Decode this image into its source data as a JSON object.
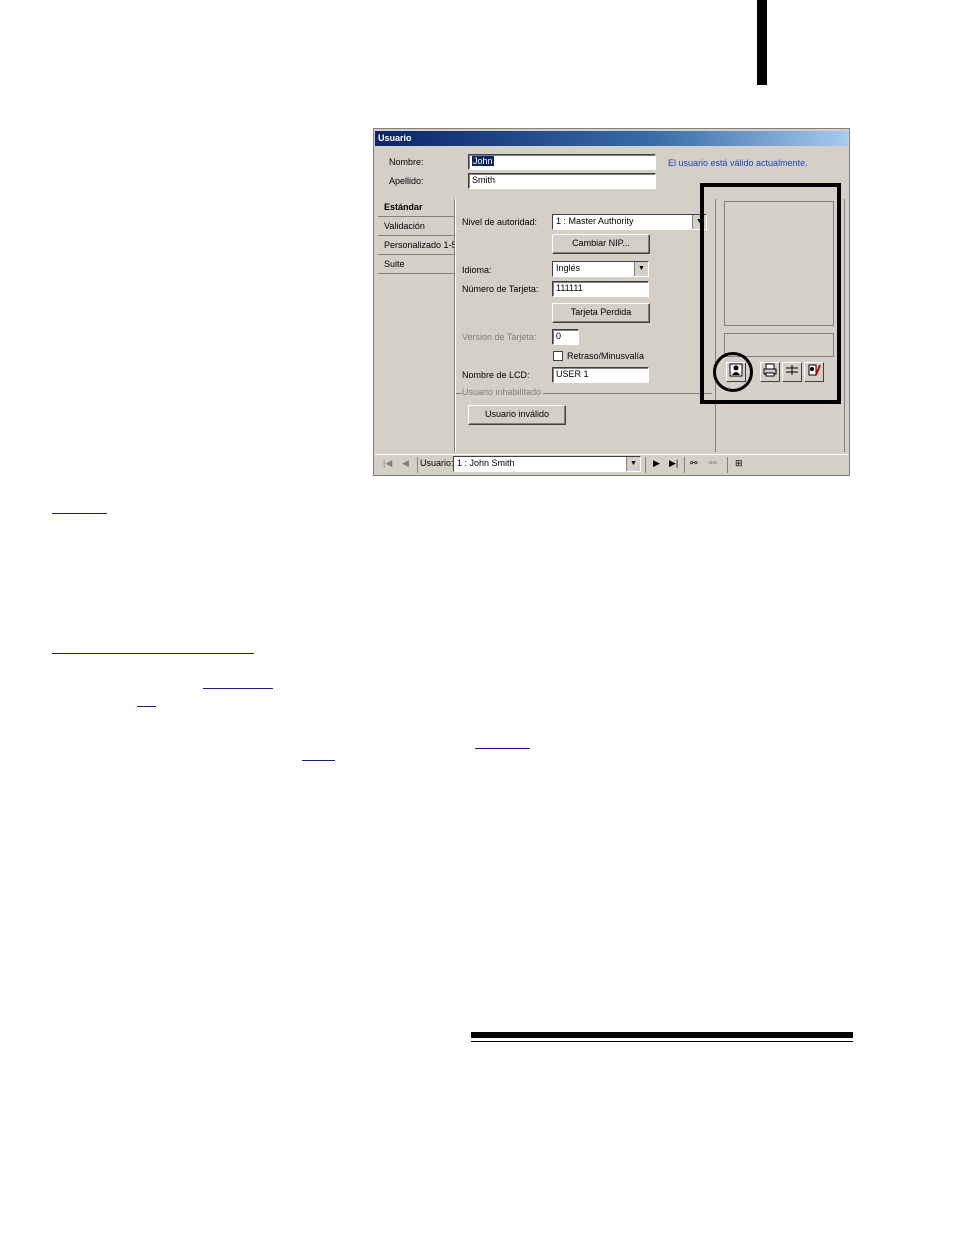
{
  "window": {
    "title": "Usuario",
    "name_label": "Nombre:",
    "name_value": "John",
    "surname_label": "Apellido:",
    "surname_value": "Smith",
    "status_text": "El usuario está válido actualmente."
  },
  "tabs": [
    "Estándar",
    "Validación",
    "Personalizado 1-5",
    "Suite"
  ],
  "standard": {
    "authority_label": "Nivel de autoridad:",
    "authority_value": "1 : Master Authority",
    "change_pin_button": "Cambiar NIP...",
    "language_label": "Idioma:",
    "language_value": "Inglés",
    "card_number_label": "Número de Tarjeta:",
    "card_number_value": "111111",
    "lost_card_button": "Tarjeta Perdida",
    "card_version_label": "Version de Tarjeta:",
    "card_version_value": "0",
    "delay_checkbox_label": "Retraso/Minusvalía",
    "lcd_name_label": "Nombre de LCD:",
    "lcd_name_value": "USER 1",
    "disabled_group_label": "Usuario inhabilitado",
    "invalid_user_button": "Usuario inválido"
  },
  "photo_panel": {
    "icons": [
      "user-photo-icon",
      "print-icon",
      "card-layout-icon",
      "settings-tool-icon"
    ]
  },
  "navbar": {
    "user_label": "Usuario:",
    "user_value": "1 : John Smith",
    "icons": [
      "first-record-icon",
      "prev-record-icon",
      "next-record-icon",
      "last-record-icon",
      "find-icon",
      "find-next-icon",
      "new-record-icon"
    ]
  },
  "colors": {
    "window_bg": "#d4d0c8",
    "title_gradient_start": "#0a246a",
    "status_text": "#1f3fbf"
  }
}
